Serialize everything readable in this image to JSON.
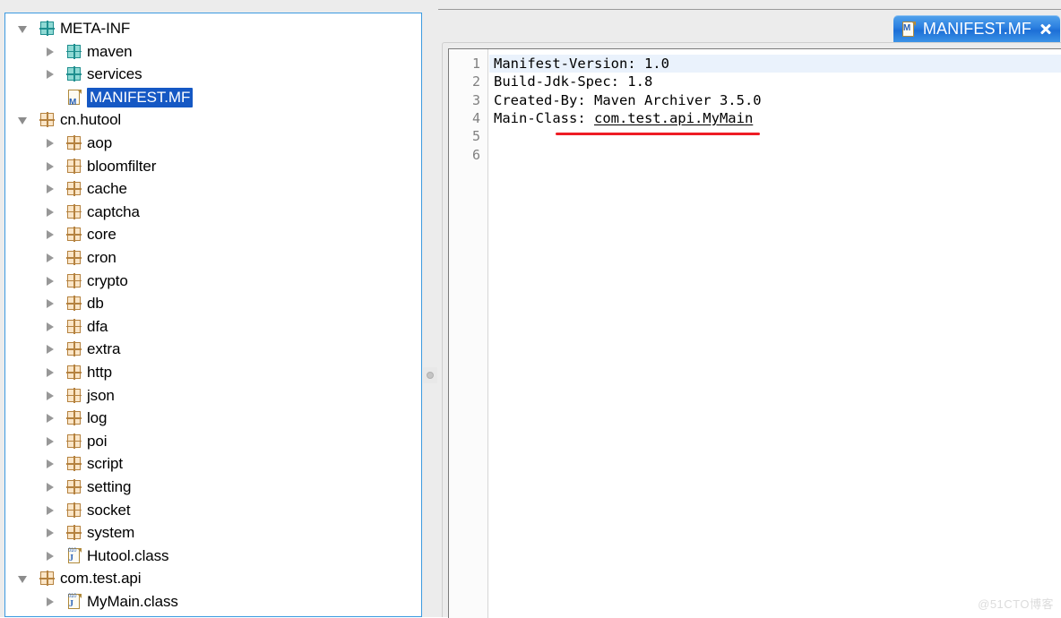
{
  "window": {
    "background": "#ececec",
    "focus_border_color": "#3c9ae0",
    "selection_color": "#1558c4",
    "accent_red": "#ee1c24"
  },
  "tree": {
    "name": "jar-package-explorer",
    "items": [
      {
        "label": "META-INF",
        "depth": 0,
        "icon": "package-icon-teal",
        "expander": "expanded",
        "selected": false
      },
      {
        "label": "maven",
        "depth": 1,
        "icon": "package-icon-teal",
        "expander": "collapsed",
        "selected": false
      },
      {
        "label": "services",
        "depth": 1,
        "icon": "package-icon-teal",
        "expander": "collapsed",
        "selected": false
      },
      {
        "label": "MANIFEST.MF",
        "depth": 1,
        "icon": "manifest-file-icon",
        "expander": "none",
        "selected": true
      },
      {
        "label": "cn.hutool",
        "depth": 0,
        "icon": "package-icon",
        "expander": "expanded",
        "selected": false
      },
      {
        "label": "aop",
        "depth": 1,
        "icon": "package-icon",
        "expander": "collapsed",
        "selected": false
      },
      {
        "label": "bloomfilter",
        "depth": 1,
        "icon": "package-icon",
        "expander": "collapsed",
        "selected": false
      },
      {
        "label": "cache",
        "depth": 1,
        "icon": "package-icon",
        "expander": "collapsed",
        "selected": false
      },
      {
        "label": "captcha",
        "depth": 1,
        "icon": "package-icon",
        "expander": "collapsed",
        "selected": false
      },
      {
        "label": "core",
        "depth": 1,
        "icon": "package-icon",
        "expander": "collapsed",
        "selected": false
      },
      {
        "label": "cron",
        "depth": 1,
        "icon": "package-icon",
        "expander": "collapsed",
        "selected": false
      },
      {
        "label": "crypto",
        "depth": 1,
        "icon": "package-icon",
        "expander": "collapsed",
        "selected": false
      },
      {
        "label": "db",
        "depth": 1,
        "icon": "package-icon",
        "expander": "collapsed",
        "selected": false
      },
      {
        "label": "dfa",
        "depth": 1,
        "icon": "package-icon",
        "expander": "collapsed",
        "selected": false
      },
      {
        "label": "extra",
        "depth": 1,
        "icon": "package-icon",
        "expander": "collapsed",
        "selected": false
      },
      {
        "label": "http",
        "depth": 1,
        "icon": "package-icon",
        "expander": "collapsed",
        "selected": false
      },
      {
        "label": "json",
        "depth": 1,
        "icon": "package-icon",
        "expander": "collapsed",
        "selected": false
      },
      {
        "label": "log",
        "depth": 1,
        "icon": "package-icon",
        "expander": "collapsed",
        "selected": false
      },
      {
        "label": "poi",
        "depth": 1,
        "icon": "package-icon",
        "expander": "collapsed",
        "selected": false
      },
      {
        "label": "script",
        "depth": 1,
        "icon": "package-icon",
        "expander": "collapsed",
        "selected": false
      },
      {
        "label": "setting",
        "depth": 1,
        "icon": "package-icon",
        "expander": "collapsed",
        "selected": false
      },
      {
        "label": "socket",
        "depth": 1,
        "icon": "package-icon",
        "expander": "collapsed",
        "selected": false
      },
      {
        "label": "system",
        "depth": 1,
        "icon": "package-icon",
        "expander": "collapsed",
        "selected": false
      },
      {
        "label": "Hutool.class",
        "depth": 1,
        "icon": "class-file-icon",
        "expander": "collapsed",
        "selected": false
      },
      {
        "label": "com.test.api",
        "depth": 0,
        "icon": "package-icon",
        "expander": "expanded",
        "selected": false
      },
      {
        "label": "MyMain.class",
        "depth": 1,
        "icon": "class-file-icon",
        "expander": "collapsed",
        "selected": false
      }
    ]
  },
  "editor": {
    "tab": {
      "title": "MANIFEST.MF",
      "icon": "manifest-file-icon",
      "close_icon": "close-icon",
      "active": true
    },
    "current_line": 1,
    "line_numbers": [
      "1",
      "2",
      "3",
      "4",
      "5",
      "6"
    ],
    "lines": [
      {
        "n": "1",
        "text": "Manifest-Version: 1.0"
      },
      {
        "n": "2",
        "text": "Build-Jdk-Spec: 1.8"
      },
      {
        "n": "3",
        "text": "Created-By: Maven Archiver 3.5.0"
      },
      {
        "n": "4",
        "prefix": "Main-Class: ",
        "value": "com.test.api.MyMain"
      },
      {
        "n": "5",
        "text": ""
      },
      {
        "n": "6",
        "text": ""
      }
    ],
    "annotation": {
      "type": "red-underline",
      "target_line": 4
    }
  },
  "splitter": {
    "handle_icon": "sash-handle-dot"
  },
  "watermark": {
    "text": "@51CTO博客"
  }
}
